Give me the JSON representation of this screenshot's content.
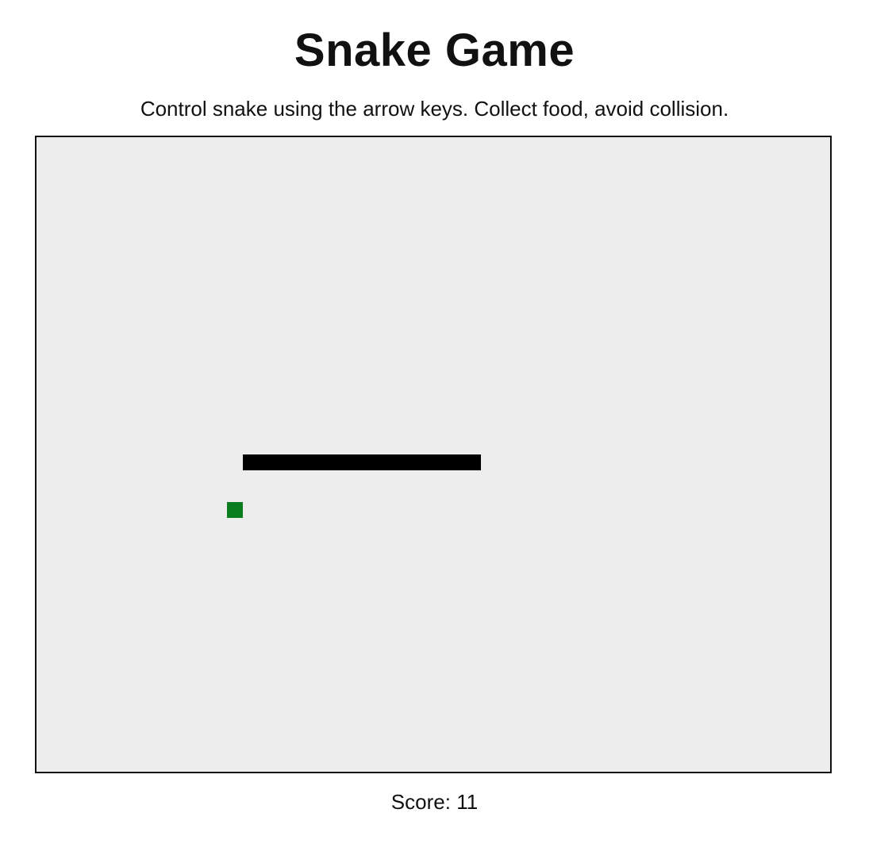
{
  "page": {
    "title": "Snake Game",
    "instructions": "Control snake using the arrow keys. Collect food, avoid collision."
  },
  "score": {
    "label": "Score:",
    "value": "11"
  },
  "game": {
    "grid_cols": 50,
    "grid_rows": 40,
    "board_color": "#ededed",
    "snake_color": "#000000",
    "food_color": "#0a7d1e",
    "snake": [
      {
        "col": 27,
        "row": 20
      },
      {
        "col": 26,
        "row": 20
      },
      {
        "col": 25,
        "row": 20
      },
      {
        "col": 24,
        "row": 20
      },
      {
        "col": 23,
        "row": 20
      },
      {
        "col": 22,
        "row": 20
      },
      {
        "col": 21,
        "row": 20
      },
      {
        "col": 20,
        "row": 20
      },
      {
        "col": 19,
        "row": 20
      },
      {
        "col": 18,
        "row": 20
      },
      {
        "col": 17,
        "row": 20
      },
      {
        "col": 16,
        "row": 20
      },
      {
        "col": 15,
        "row": 20
      },
      {
        "col": 14,
        "row": 20
      },
      {
        "col": 13,
        "row": 20
      }
    ],
    "food": {
      "col": 12,
      "row": 23
    }
  }
}
